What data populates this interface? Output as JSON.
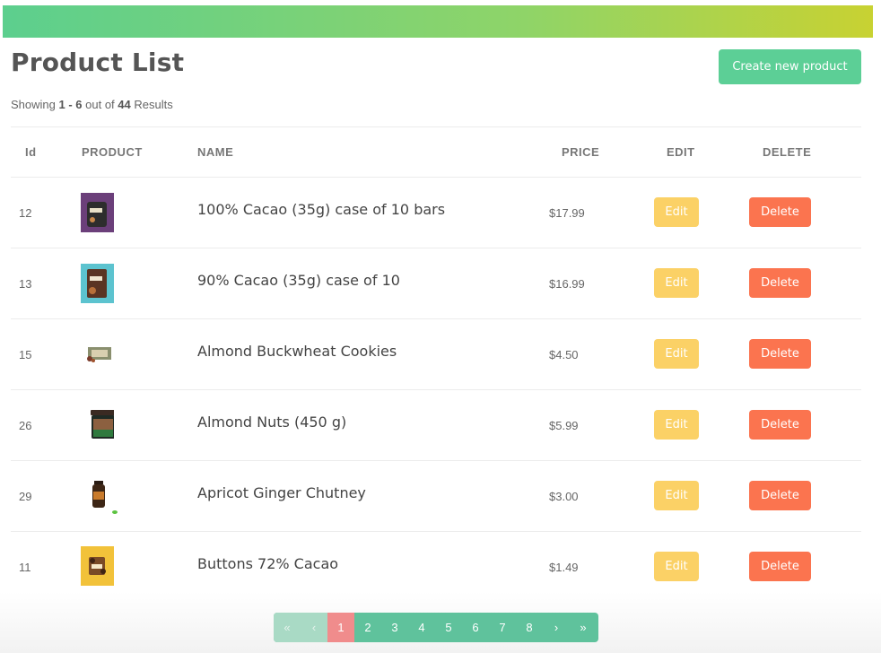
{
  "header": {
    "title": "Product List",
    "create_label": "Create new product"
  },
  "results": {
    "prefix": "Showing",
    "range": "1 - 6",
    "mid": "out of",
    "total": "44",
    "suffix": "Results"
  },
  "table": {
    "columns": {
      "id": "Id",
      "product": "PRODUCT",
      "name": "NAME",
      "price": "PRICE",
      "edit": "EDIT",
      "delete": "DELETE"
    },
    "rows": [
      {
        "id": "12",
        "name": "100% Cacao (35g) case of 10 bars",
        "price": "$17.99",
        "edit_label": "Edit",
        "delete_label": "Delete"
      },
      {
        "id": "13",
        "name": "90% Cacao (35g) case of 10",
        "price": "$16.99",
        "edit_label": "Edit",
        "delete_label": "Delete"
      },
      {
        "id": "15",
        "name": "Almond Buckwheat Cookies",
        "price": "$4.50",
        "edit_label": "Edit",
        "delete_label": "Delete"
      },
      {
        "id": "26",
        "name": "Almond Nuts (450 g)",
        "price": "$5.99",
        "edit_label": "Edit",
        "delete_label": "Delete"
      },
      {
        "id": "29",
        "name": "Apricot Ginger Chutney",
        "price": "$3.00",
        "edit_label": "Edit",
        "delete_label": "Delete"
      },
      {
        "id": "11",
        "name": "Buttons 72% Cacao",
        "price": "$1.49",
        "edit_label": "Edit",
        "delete_label": "Delete"
      }
    ]
  },
  "pagination": {
    "first": "«",
    "prev": "‹",
    "next": "›",
    "last": "»",
    "pages": [
      "1",
      "2",
      "3",
      "4",
      "5",
      "6",
      "7",
      "8"
    ],
    "current": "1"
  },
  "colors": {
    "accent_green": "#5ccf96",
    "edit": "#fbd166",
    "delete": "#fb744f",
    "pagination": "#5fc29c",
    "active_page": "#f08c8c"
  }
}
